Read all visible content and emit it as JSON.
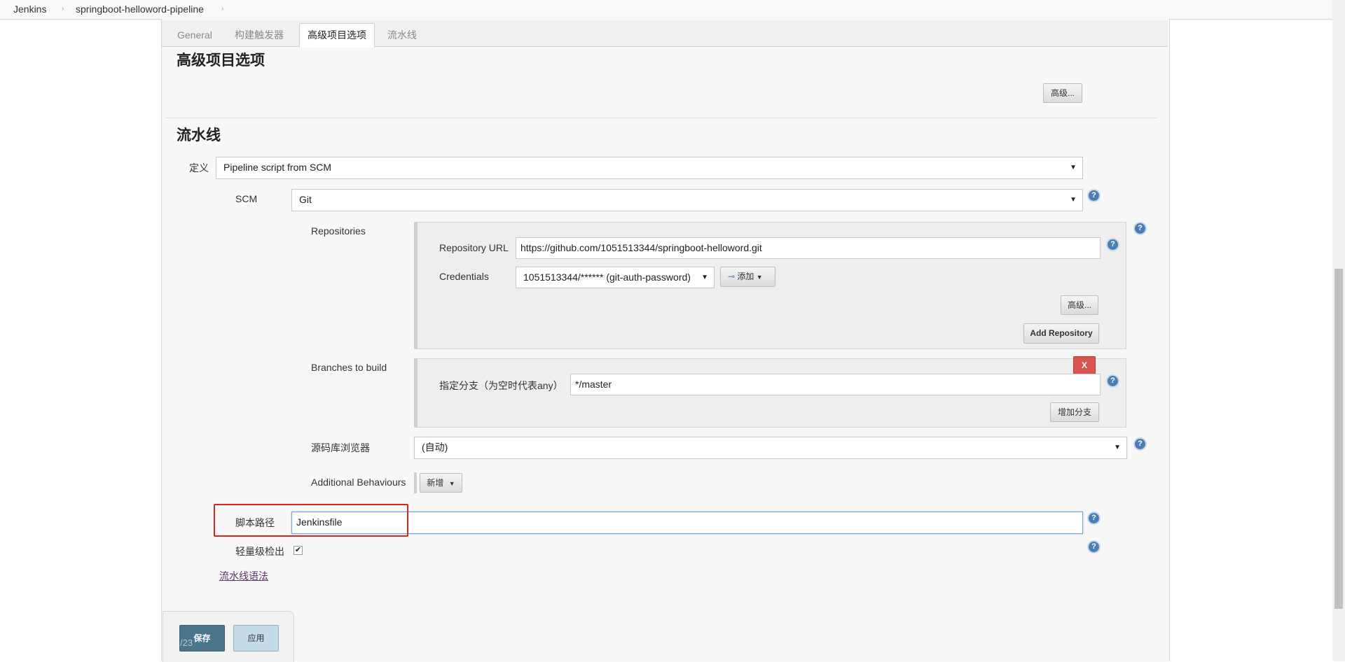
{
  "breadcrumb": {
    "items": [
      "Jenkins",
      "springboot-helloword-pipeline"
    ]
  },
  "tabs": [
    "General",
    "构建触发器",
    "高级项目选项",
    "流水线"
  ],
  "active_tab": "高级项目选项",
  "advanced_section": {
    "title": "高级项目选项",
    "advanced_button": "高级..."
  },
  "pipeline_section": {
    "title": "流水线",
    "definition_label": "定义",
    "definition_value": "Pipeline script from SCM",
    "scm_label": "SCM",
    "scm_value": "Git",
    "repositories_label": "Repositories",
    "repo_url_label": "Repository URL",
    "repo_url_value": "https://github.com/1051513344/springboot-helloword.git",
    "credentials_label": "Credentials",
    "credentials_value": "1051513344/****** (git-auth-password)",
    "add_button": "添加",
    "repo_advanced_button": "高级...",
    "add_repository_button": "Add Repository",
    "branches_label": "Branches to build",
    "delete_branch_button": "X",
    "branch_spec_label": "指定分支（为空时代表any）",
    "branch_spec_value": "*/master",
    "add_branch_button": "增加分支",
    "repo_browser_label": "源码库浏览器",
    "repo_browser_value": "(自动)",
    "additional_behaviours_label": "Additional Behaviours",
    "new_button": "新增",
    "script_path_label": "脚本路径",
    "script_path_value": "Jenkinsfile",
    "lightweight_label": "轻量级检出",
    "lightweight_checked": true,
    "pipeline_syntax_link": "流水线语法"
  },
  "bottom": {
    "save_button": "保存",
    "apply_button": "应用",
    "page_indicator": "/23"
  },
  "colors": {
    "save_bg": "#4b758b",
    "apply_bg": "#c6dbe8",
    "highlight": "#d9261c",
    "help": "#4a7fb5",
    "delete_bg": "#d9534f"
  }
}
